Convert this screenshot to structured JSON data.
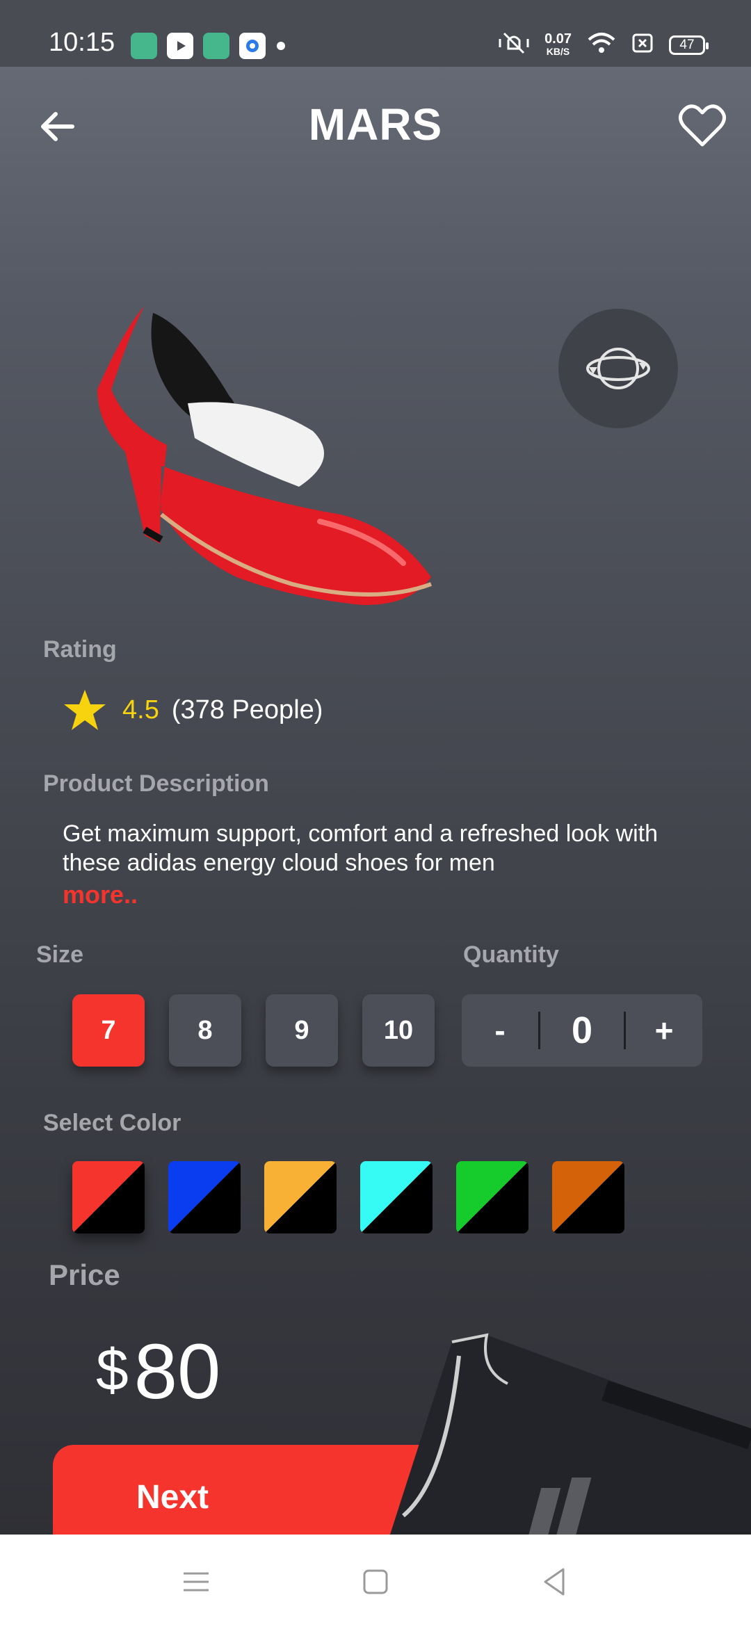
{
  "status_bar": {
    "time": "10:15",
    "net_speed": "0.07",
    "net_unit": "KB/S",
    "battery": "47"
  },
  "header": {
    "title": "MARS"
  },
  "rating": {
    "label": "Rating",
    "value": "4.5",
    "count": "(378 People)"
  },
  "description": {
    "label": "Product Description",
    "text": "Get maximum support, comfort and a refreshed look with these adidas energy cloud shoes for men",
    "more": "more.."
  },
  "size": {
    "label": "Size",
    "options": [
      "7",
      "8",
      "9",
      "10"
    ],
    "selected": "7"
  },
  "quantity": {
    "label": "Quantity",
    "minus": "-",
    "value": "0",
    "plus": "+"
  },
  "colors": {
    "label": "Select Color",
    "swatches": [
      "#f5352d",
      "#0a3cf0",
      "#f8b035",
      "#35fbf4",
      "#16cc2c",
      "#d36208"
    ],
    "selected_index": 0
  },
  "price": {
    "label": "Price",
    "currency": "$",
    "value": "80"
  },
  "next_button": {
    "label": "Next"
  },
  "colors_theme": {
    "accent": "#f5352d",
    "star": "#f6d20f"
  }
}
